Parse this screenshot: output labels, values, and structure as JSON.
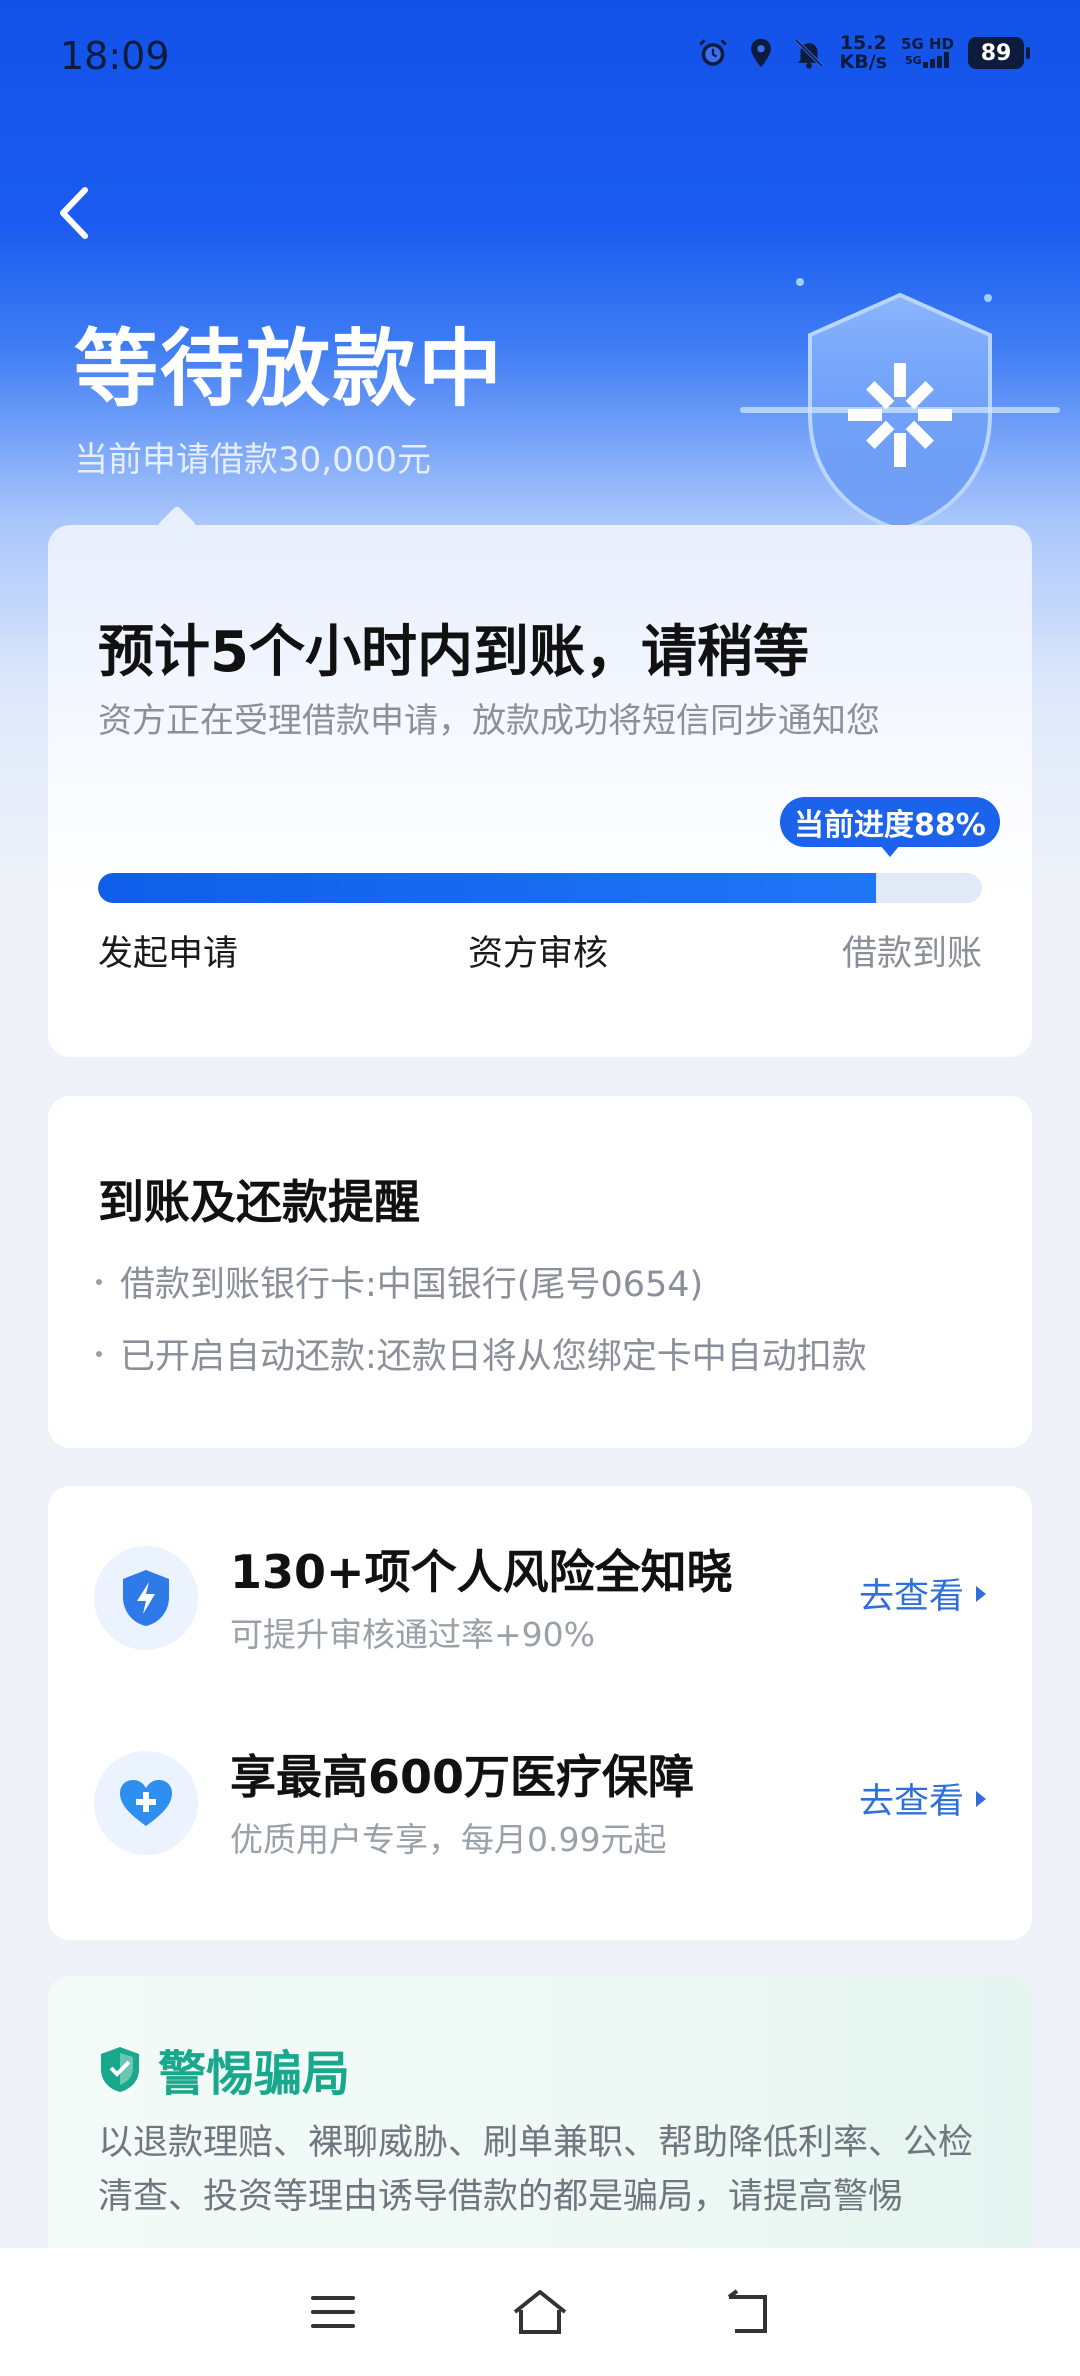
{
  "status_bar": {
    "time": "18:09",
    "net_speed_value": "15.2",
    "net_speed_unit": "KB/s",
    "signal_label_1": "5G HD",
    "signal_label_2": "5G",
    "battery": "89",
    "icons": [
      "alarm-icon",
      "location-icon",
      "mute-bell-icon",
      "signal-icon",
      "battery-icon"
    ]
  },
  "header": {
    "title": "等待放款中",
    "subtitle": "当前申请借款30,000元"
  },
  "progress_card": {
    "title": "预计5个小时内到账，请稍等",
    "description": "资方正在受理借款申请，放款成功将短信同步通知您",
    "badge": "当前进度88%",
    "progress_percent": 88,
    "steps": [
      "发起申请",
      "资方审核",
      "借款到账"
    ]
  },
  "reminder_card": {
    "title": "到账及还款提醒",
    "items": [
      "借款到账银行卡:中国银行(尾号0654)",
      "已开启自动还款:还款日将从您绑定卡中自动扣款"
    ]
  },
  "services": [
    {
      "title": "130+项个人风险全知晓",
      "subtitle": "可提升审核通过率+90%",
      "link": "去查看",
      "icon": "shield-lightning-icon"
    },
    {
      "title": "享最高600万医疗保障",
      "subtitle": "优质用户专享，每月0.99元起",
      "link": "去查看",
      "icon": "heart-plus-icon"
    }
  ],
  "warning_card": {
    "title": "警惕骗局",
    "text": "以退款理赔、裸聊威胁、刷单兼职、帮助降低利率、公检清查、投资等理由诱导借款的都是骗局，请提高警惕"
  },
  "colors": {
    "primary": "#1a63ea",
    "header_bg": "#1352e8",
    "warning": "#19a88b"
  }
}
